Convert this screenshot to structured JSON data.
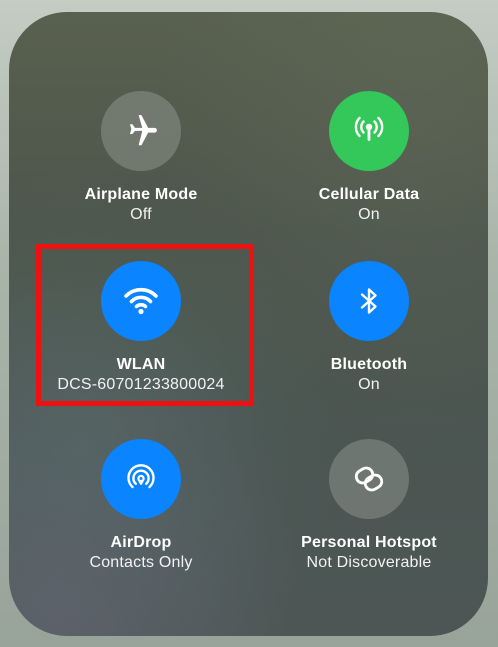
{
  "tiles": {
    "airplane": {
      "label": "Airplane Mode",
      "status": "Off",
      "icon": "airplane-icon",
      "color": "#8c928a"
    },
    "cellular": {
      "label": "Cellular Data",
      "status": "On",
      "icon": "cellular-antenna-icon",
      "color": "#34c759"
    },
    "wlan": {
      "label": "WLAN",
      "status": "DCS-60701233800024",
      "icon": "wifi-icon",
      "color": "#0a84ff"
    },
    "bluetooth": {
      "label": "Bluetooth",
      "status": "On",
      "icon": "bluetooth-icon",
      "color": "#0a84ff"
    },
    "airdrop": {
      "label": "AirDrop",
      "status": "Contacts Only",
      "icon": "airdrop-icon",
      "color": "#0a84ff"
    },
    "hotspot": {
      "label": "Personal Hotspot",
      "status": "Not Discoverable",
      "icon": "hotspot-link-icon",
      "color": "#8c928a"
    }
  },
  "highlight_color": "#ee1111"
}
